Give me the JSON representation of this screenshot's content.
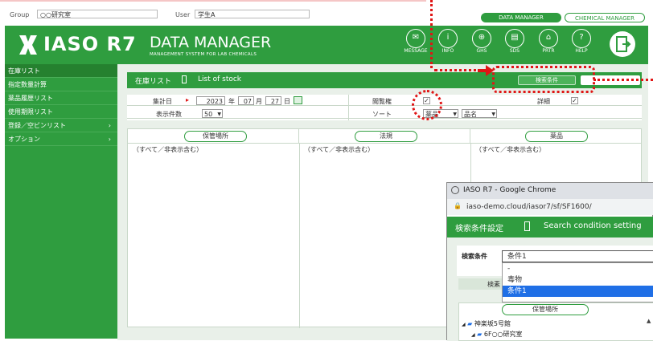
{
  "topbar": {
    "group_label": "Group",
    "group_value": "○○研究室",
    "user_label": "User",
    "user_value": "学生A",
    "data_manager_btn": "DATA MANAGER",
    "chemical_manager_btn": "CHEMICAL MANAGER"
  },
  "header": {
    "logo_main": "IASO R7",
    "logo_title": "DATA MANAGER",
    "logo_subtitle": "MANAGEMENT SYSTEM FOR LAB CHEMICALS",
    "icons": [
      {
        "label": "MESSAGE",
        "icon": "envelope-icon",
        "glyph": "✉"
      },
      {
        "label": "INFO",
        "icon": "info-icon",
        "glyph": "i"
      },
      {
        "label": "GHS",
        "icon": "globe-icon",
        "glyph": "⊕"
      },
      {
        "label": "SDS",
        "icon": "document-icon",
        "glyph": "▤"
      },
      {
        "label": "PRTR",
        "icon": "building-icon",
        "glyph": "⌂"
      },
      {
        "label": "HELP",
        "icon": "help-icon",
        "glyph": "?"
      }
    ]
  },
  "sidebar": {
    "items": [
      {
        "label": "在庫リスト",
        "active": true
      },
      {
        "label": "指定数量計算"
      },
      {
        "label": "薬品履歴リスト"
      },
      {
        "label": "使用期限リスト"
      },
      {
        "label": "登録／空ビンリスト",
        "arrow": "›"
      },
      {
        "label": "オプション",
        "arrow": "›"
      }
    ]
  },
  "main": {
    "title_jp": "在庫リスト",
    "title_en": "List of stock",
    "search_button": "検索条件",
    "form": {
      "date_label": "集計日",
      "year": "2023",
      "year_unit": "年",
      "month": "07",
      "month_unit": "月",
      "day": "27",
      "day_unit": "日",
      "display_count_label": "表示件数",
      "display_count_value": "50",
      "reference_label": "閲覧権",
      "reference_checked": "✓",
      "detail_label": "詳細",
      "detail_checked": "✓",
      "sort_label": "ソート",
      "sort_value1": "薬品",
      "sort_value2": "品名"
    },
    "columns": [
      {
        "header": "保管場所",
        "content": "（すべて／非表示含む）"
      },
      {
        "header": "法規",
        "content": "（すべて／非表示含む）"
      },
      {
        "header": "薬品",
        "content": "（すべて／非表示含む）"
      }
    ]
  },
  "popup": {
    "window_title": "IASO R7 - Google Chrome",
    "url": "iaso-demo.cloud/iasor7/sf/SF1600/",
    "title_jp": "検索条件設定",
    "title_en": "Search condition setting",
    "condition_label": "検索条件",
    "condition_value": "条件1",
    "dropdown_options": [
      "-",
      "毒物",
      "条件1"
    ],
    "hidden_label": "検素",
    "location_button": "保管場所",
    "tree": [
      {
        "label": "神楽坂5号館",
        "level": 0
      },
      {
        "label": "6F○○研究室",
        "level": 1
      }
    ]
  },
  "colors": {
    "brand_green": "#2f9d3f",
    "dark_green": "#25812f",
    "highlight_blue": "#1f6fe6",
    "annotation_red": "#e01515"
  }
}
